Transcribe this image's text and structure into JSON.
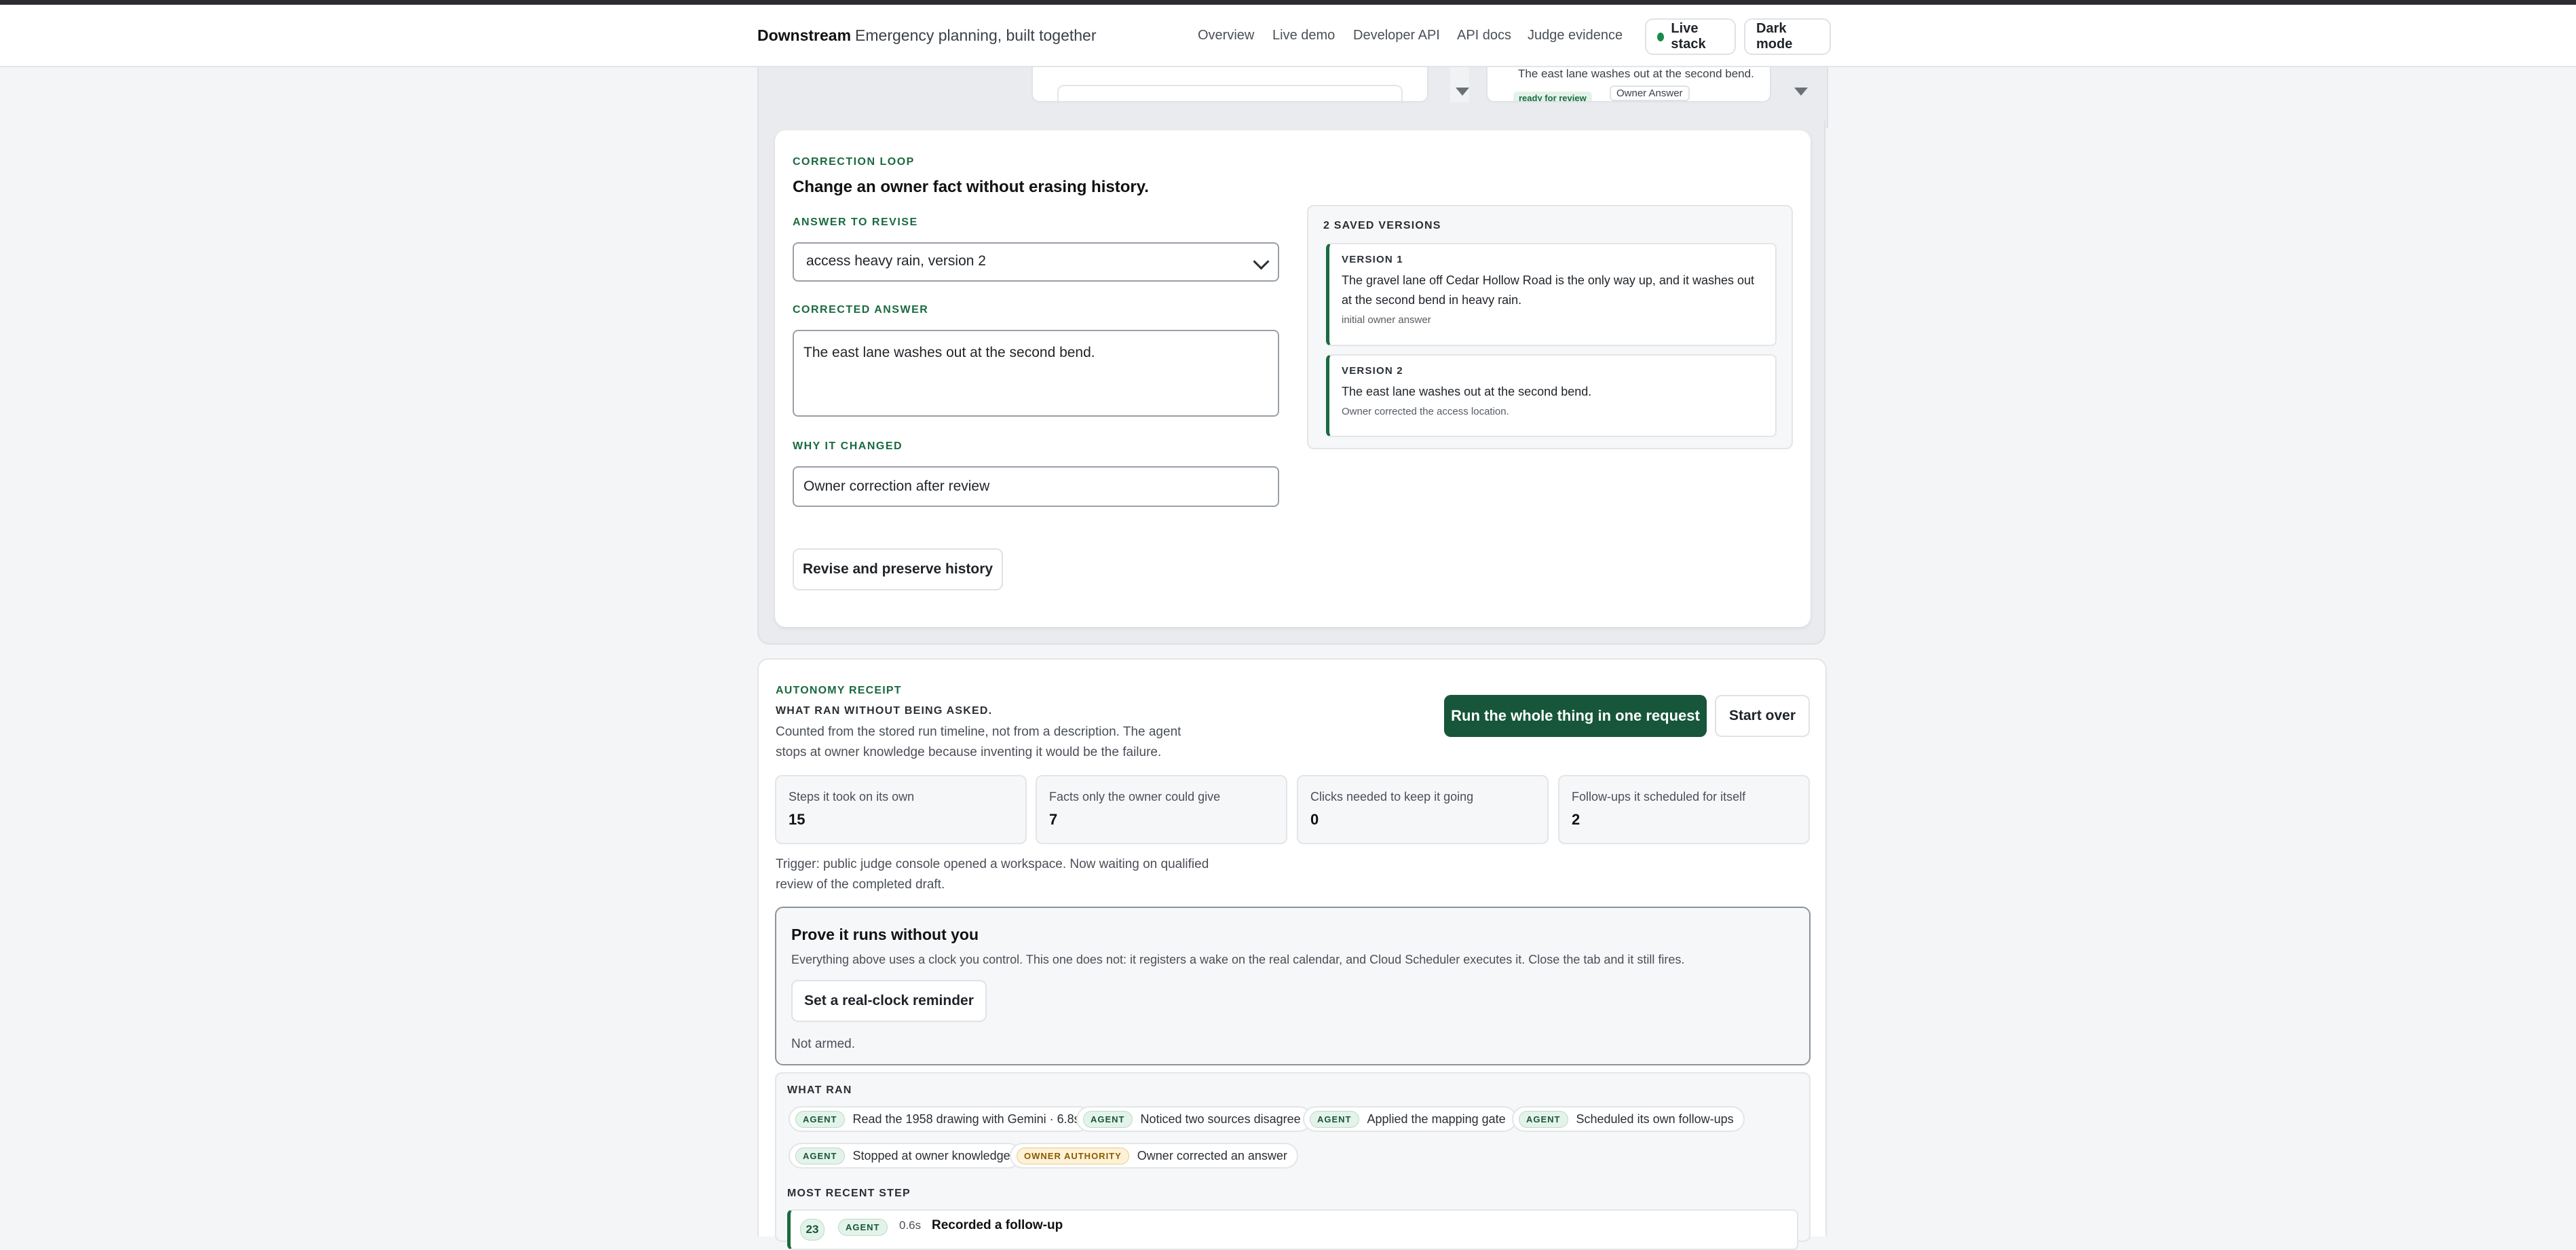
{
  "nav": {
    "brand": "Downstream",
    "tagline": "Emergency planning, built together",
    "links": [
      "Overview",
      "Live demo",
      "Developer API",
      "API docs",
      "Judge evidence"
    ],
    "live_stack": "Live stack",
    "dark_mode": "Dark mode"
  },
  "top_panel": {
    "text": "The east lane washes out at the second bend.",
    "badge": "ready for review",
    "chip": "Owner Answer"
  },
  "correction": {
    "eyebrow": "CORRECTION LOOP",
    "title": "Change an owner fact without erasing history.",
    "answer_label": "ANSWER TO REVISE",
    "answer_value": "access heavy rain, version 2",
    "corrected_label": "CORRECTED ANSWER",
    "corrected_value": "The east lane washes out at the second bend.",
    "why_label": "WHY IT CHANGED",
    "why_value": "Owner correction after review",
    "button": "Revise and preserve history",
    "versions_title": "2 SAVED VERSIONS",
    "versions": [
      {
        "label": "VERSION 1",
        "text": "The gravel lane off Cedar Hollow Road is the only way up, and it washes out at the second bend in heavy rain.",
        "note": "initial owner answer"
      },
      {
        "label": "VERSION 2",
        "text": "The east lane washes out at the second bend.",
        "note": "Owner corrected the access location."
      }
    ]
  },
  "autonomy": {
    "eyebrow": "AUTONOMY RECEIPT",
    "subtitle": "WHAT RAN WITHOUT BEING ASKED.",
    "desc_line1": "Counted from the stored run timeline, not from a description. The agent",
    "desc_line2": "stops at owner knowledge because inventing it would be the failure.",
    "run_button": "Run the whole thing in one request",
    "start_over": "Start over",
    "stats": [
      {
        "label": "Steps it took on its own",
        "value": "15"
      },
      {
        "label": "Facts only the owner could give",
        "value": "7"
      },
      {
        "label": "Clicks needed to keep it going",
        "value": "0"
      },
      {
        "label": "Follow-ups it scheduled for itself",
        "value": "2"
      }
    ],
    "trigger_line1": "Trigger: public judge console opened a workspace. Now waiting on qualified",
    "trigger_line2": "review of the completed draft.",
    "prove_title": "Prove it runs without you",
    "prove_desc": "Everything above uses a clock you control. This one does not: it registers a wake on the real calendar, and Cloud Scheduler executes it. Close the tab and it still fires.",
    "reminder_button": "Set a real-clock reminder",
    "armed_status": "Not armed.",
    "what_ran_label": "WHAT RAN",
    "steps": [
      {
        "tag": "AGENT",
        "text": "Read the 1958 drawing with Gemini · 6.8s"
      },
      {
        "tag": "AGENT",
        "text": "Noticed two sources disagree"
      },
      {
        "tag": "AGENT",
        "text": "Applied the mapping gate"
      },
      {
        "tag": "AGENT",
        "text": "Scheduled its own follow-ups"
      },
      {
        "tag": "AGENT",
        "text": "Stopped at owner knowledge"
      },
      {
        "tag": "OWNER AUTHORITY",
        "text": "Owner corrected an answer"
      }
    ],
    "recent_label": "MOST RECENT STEP",
    "recent": {
      "num": "23",
      "tag": "AGENT",
      "time": "0.6s",
      "text": "Recorded a follow-up"
    }
  }
}
